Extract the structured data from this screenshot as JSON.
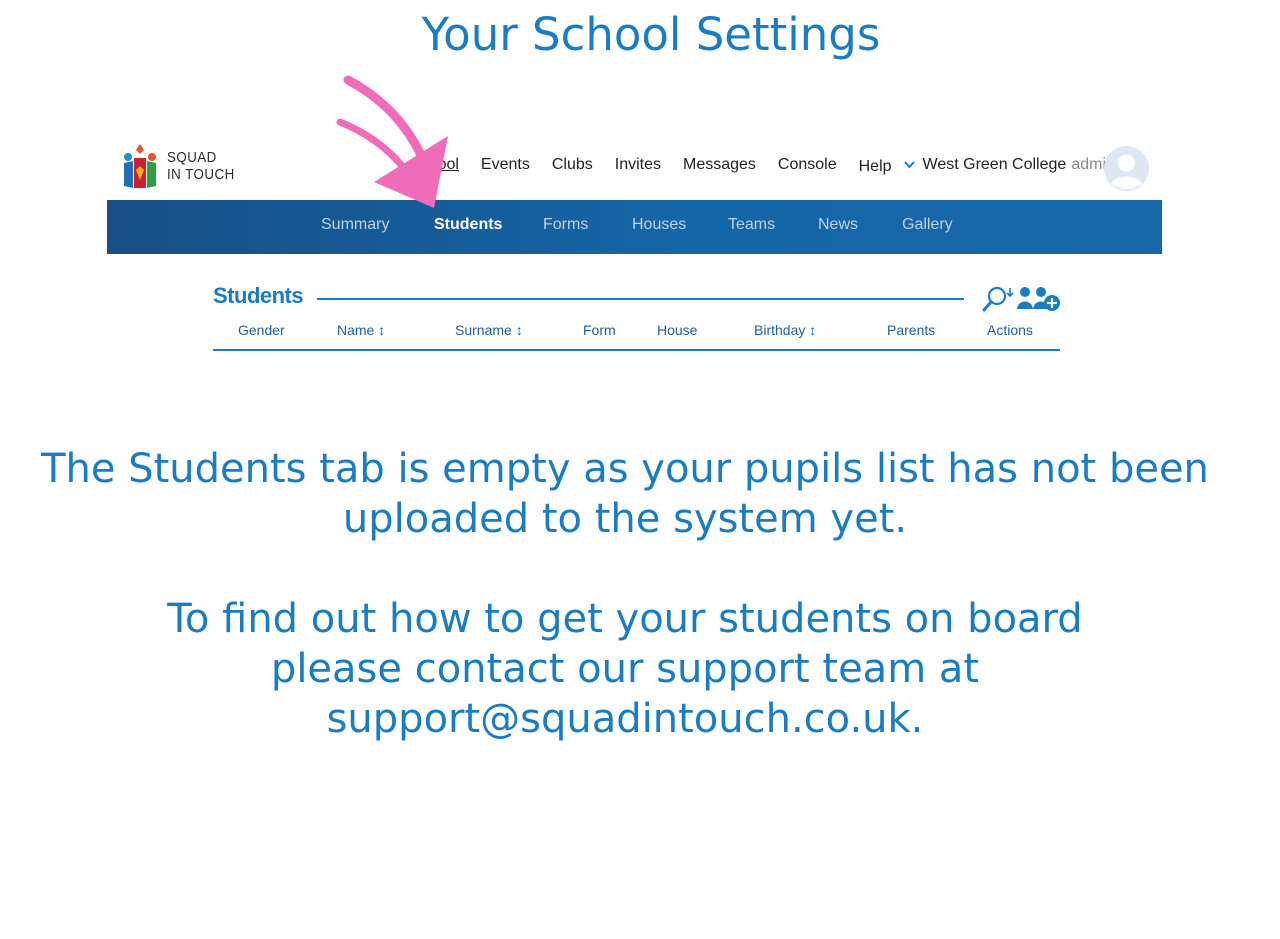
{
  "page_title": "Your School Settings",
  "logo": {
    "line1": "SQUAD",
    "line2": "IN TOUCH",
    "icon": "squad-in-touch-logo"
  },
  "topnav": {
    "items": [
      "School",
      "Events",
      "Clubs",
      "Invites",
      "Messages",
      "Console",
      "Help"
    ],
    "active": "School",
    "school_name": "West Green College",
    "role": "admin",
    "dropdown_icon": "chevron-down-icon",
    "avatar_icon": "user-avatar-icon"
  },
  "subnav": {
    "tabs": [
      "Summary",
      "Students",
      "Forms",
      "Houses",
      "Teams",
      "News",
      "Gallery"
    ],
    "active": "Students"
  },
  "students": {
    "title": "Students",
    "columns": [
      "Gender",
      "Name ↕",
      "Surname ↕",
      "Form",
      "House",
      "Birthday ↕",
      "Parents",
      "Actions"
    ],
    "tools": [
      "search-filter-icon",
      "add-student-icon"
    ]
  },
  "message": {
    "line1": "The Students tab is empty as your pupils list has not been",
    "line2": "uploaded to the system yet.",
    "line3": "To find out how to get your students on board",
    "line4": "please contact our support team at",
    "line5": "support@squadintouch.co.uk."
  },
  "colors": {
    "accent": "#1a7dc1",
    "nav_bar": "#1566a7",
    "arrow": "#f06bb8"
  }
}
